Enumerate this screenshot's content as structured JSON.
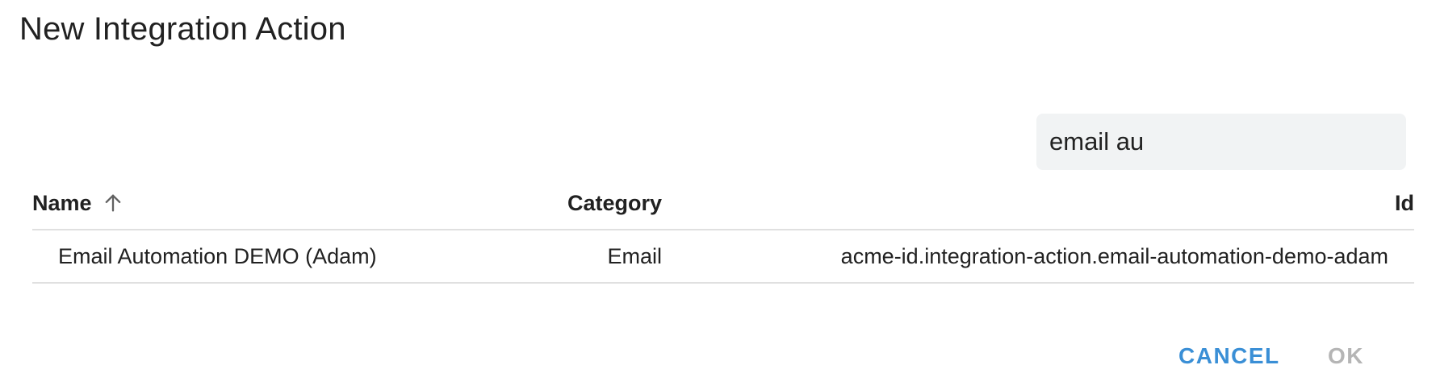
{
  "dialog": {
    "title": "New Integration Action"
  },
  "search": {
    "value": "email au"
  },
  "table": {
    "columns": {
      "name": "Name",
      "category": "Category",
      "id": "Id"
    },
    "sort": {
      "column": "name",
      "direction": "ascending",
      "icon": "arrow-up-icon"
    },
    "rows": [
      {
        "name": "Email Automation DEMO (Adam)",
        "category": "Email",
        "id": "acme-id.integration-action.email-automation-demo-adam"
      }
    ]
  },
  "actions": {
    "cancel_label": "CANCEL",
    "ok_label": "OK",
    "ok_disabled": true
  },
  "colors": {
    "accent": "#3a8fd6",
    "disabled": "#b5b5b5",
    "search_bg": "#f1f3f4",
    "divider": "#e0e0e0"
  }
}
